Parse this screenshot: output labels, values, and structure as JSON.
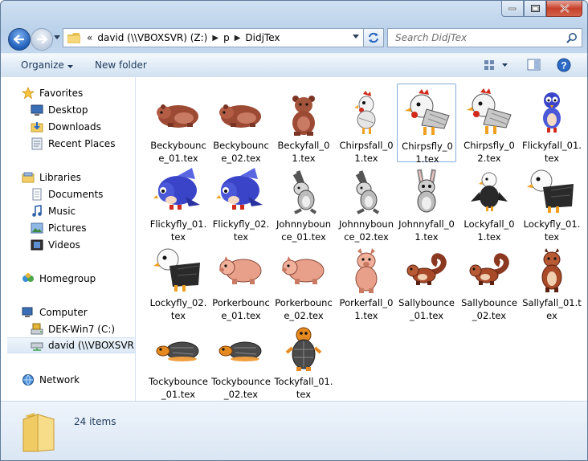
{
  "address": {
    "crumbs": [
      "david (\\\\VBOXSVR) (Z:)",
      "p",
      "DidjTex"
    ],
    "overflow_glyph": "«"
  },
  "search": {
    "placeholder": "Search DidjTex"
  },
  "toolbar": {
    "organize": "Organize",
    "new_folder": "New folder"
  },
  "sidebar": {
    "favorites": {
      "label": "Favorites",
      "items": [
        "Desktop",
        "Downloads",
        "Recent Places"
      ]
    },
    "libraries": {
      "label": "Libraries",
      "items": [
        "Documents",
        "Music",
        "Pictures",
        "Videos"
      ]
    },
    "homegroup": {
      "label": "Homegroup"
    },
    "computer": {
      "label": "Computer",
      "items": [
        "DEK-Win7 (C:)",
        "david (\\\\VBOXSVR) ("
      ]
    },
    "network": {
      "label": "Network"
    }
  },
  "files": [
    {
      "name": "Beckybounce_01.tex",
      "sprite": "bear-bounce"
    },
    {
      "name": "Beckybounce_02.tex",
      "sprite": "bear-bounce"
    },
    {
      "name": "Beckyfall_01.tex",
      "sprite": "bear-sit"
    },
    {
      "name": "Chirpsfall_01.tex",
      "sprite": "chicken-small"
    },
    {
      "name": "Chirpsfly_01.tex",
      "sprite": "chicken"
    },
    {
      "name": "Chirpsfly_02.tex",
      "sprite": "chicken"
    },
    {
      "name": "Flickyfall_01.tex",
      "sprite": "bird-small"
    },
    {
      "name": "Flickyfly_01.tex",
      "sprite": "bluebird"
    },
    {
      "name": "Flickyfly_02.tex",
      "sprite": "bluebird"
    },
    {
      "name": "Johnnybounce_01.tex",
      "sprite": "rabbit"
    },
    {
      "name": "Johnnybounce_02.tex",
      "sprite": "rabbit"
    },
    {
      "name": "Johnnyfall_01.tex",
      "sprite": "rabbit-front"
    },
    {
      "name": "Lockyfall_01.tex",
      "sprite": "eagle-small"
    },
    {
      "name": "Lockyfly_01.tex",
      "sprite": "eagle"
    },
    {
      "name": "Lockyfly_02.tex",
      "sprite": "eagle"
    },
    {
      "name": "Porkerbounce_01.tex",
      "sprite": "pig"
    },
    {
      "name": "Porkerbounce_02.tex",
      "sprite": "pig"
    },
    {
      "name": "Porkerfall_01.tex",
      "sprite": "pig-front"
    },
    {
      "name": "Sallybounce_01.tex",
      "sprite": "squirrel"
    },
    {
      "name": "Sallybounce_02.tex",
      "sprite": "squirrel"
    },
    {
      "name": "Sallyfall_01.tex",
      "sprite": "squirrel-front"
    },
    {
      "name": "Tockybounce_01.tex",
      "sprite": "turtle"
    },
    {
      "name": "Tockybounce_02.tex",
      "sprite": "turtle"
    },
    {
      "name": "Tockyfall_01.tex",
      "sprite": "turtle-front"
    }
  ],
  "selected_file": "Chirpsfly_01.tex",
  "details": {
    "count": "24 items"
  },
  "colors": {
    "window_frame": "#b9d1ea",
    "selection_border": "#84acdd",
    "text_blue": "#1e395b"
  }
}
